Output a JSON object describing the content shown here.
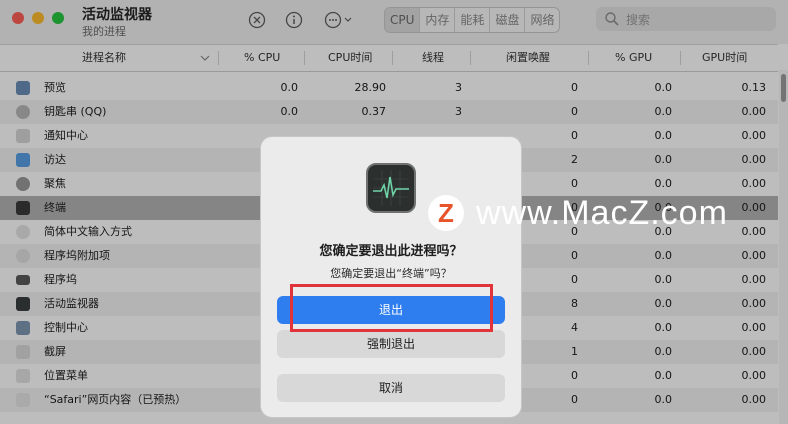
{
  "window": {
    "title": "活动监视器",
    "subtitle": "我的进程"
  },
  "toolbar": {
    "stop_icon": "x-circle-icon",
    "info_icon": "info-icon",
    "more_icon": "ellipsis-circle-icon",
    "tabs": [
      "CPU",
      "内存",
      "能耗",
      "磁盘",
      "网络"
    ],
    "active_tab": "CPU",
    "search_placeholder": "搜索"
  },
  "table": {
    "columns": [
      "进程名称",
      "% CPU",
      "CPU时间",
      "线程",
      "闲置唤醒",
      "% GPU",
      "GPU时间"
    ],
    "rows": [
      {
        "name": "预览",
        "cpu": "0.0",
        "cpu_time": "28.90",
        "threads": "3",
        "idle_wakes": "0",
        "gpu": "0.0",
        "gpu_time": "0.13",
        "icon": "preview-icon"
      },
      {
        "name": "钥匙串 (QQ)",
        "cpu": "0.0",
        "cpu_time": "0.37",
        "threads": "3",
        "idle_wakes": "0",
        "gpu": "0.0",
        "gpu_time": "0.00",
        "icon": "keychain-icon"
      },
      {
        "name": "通知中心",
        "cpu": "",
        "cpu_time": "",
        "threads": "",
        "idle_wakes": "0",
        "gpu": "0.0",
        "gpu_time": "0.00",
        "icon": "notification-icon"
      },
      {
        "name": "访达",
        "cpu": "",
        "cpu_time": "",
        "threads": "",
        "idle_wakes": "2",
        "gpu": "0.0",
        "gpu_time": "0.00",
        "icon": "finder-icon"
      },
      {
        "name": "聚焦",
        "cpu": "",
        "cpu_time": "",
        "threads": "",
        "idle_wakes": "0",
        "gpu": "0.0",
        "gpu_time": "0.00",
        "icon": "spotlight-icon"
      },
      {
        "name": "终端",
        "cpu": "",
        "cpu_time": "",
        "threads": "",
        "idle_wakes": "0",
        "gpu": "0.0",
        "gpu_time": "0.00",
        "icon": "terminal-icon"
      },
      {
        "name": "简体中文输入方式",
        "cpu": "",
        "cpu_time": "",
        "threads": "",
        "idle_wakes": "0",
        "gpu": "0.0",
        "gpu_time": "0.00",
        "icon": "input-method-icon"
      },
      {
        "name": "程序坞附加项",
        "cpu": "",
        "cpu_time": "",
        "threads": "",
        "idle_wakes": "0",
        "gpu": "0.0",
        "gpu_time": "0.00",
        "icon": "dock-extra-icon"
      },
      {
        "name": "程序坞",
        "cpu": "",
        "cpu_time": "",
        "threads": "",
        "idle_wakes": "0",
        "gpu": "0.0",
        "gpu_time": "0.00",
        "icon": "dock-icon"
      },
      {
        "name": "活动监视器",
        "cpu": "",
        "cpu_time": "",
        "threads": "",
        "idle_wakes": "8",
        "gpu": "0.0",
        "gpu_time": "0.00",
        "icon": "activity-monitor-icon"
      },
      {
        "name": "控制中心",
        "cpu": "",
        "cpu_time": "",
        "threads": "",
        "idle_wakes": "4",
        "gpu": "0.0",
        "gpu_time": "0.00",
        "icon": "control-center-icon"
      },
      {
        "name": "截屏",
        "cpu": "",
        "cpu_time": "",
        "threads": "",
        "idle_wakes": "1",
        "gpu": "0.0",
        "gpu_time": "0.00",
        "icon": "screenshot-icon"
      },
      {
        "name": "位置菜单",
        "cpu": "",
        "cpu_time": "",
        "threads": "",
        "idle_wakes": "0",
        "gpu": "0.0",
        "gpu_time": "0.00",
        "icon": "location-menu-icon"
      },
      {
        "name": "“Safari”网页内容（已预热）",
        "cpu": "",
        "cpu_time": "",
        "threads": "",
        "idle_wakes": "0",
        "gpu": "0.0",
        "gpu_time": "0.00",
        "icon": "safari-web-content-icon"
      }
    ],
    "selected_row": 5
  },
  "dialog": {
    "icon": "activity-monitor-app-icon",
    "title": "您确定要退出此进程吗？",
    "message": "您确定要退出“终端”吗？",
    "quit_label": "退出",
    "force_quit_label": "强制退出",
    "cancel_label": "取消"
  },
  "watermark": {
    "badge_letter": "Z",
    "text": "www.MacZ.com"
  },
  "colors": {
    "accent": "#2f7ef0",
    "highlight_box": "#e0343a",
    "watermark_badge_letter": "#e8542a"
  }
}
